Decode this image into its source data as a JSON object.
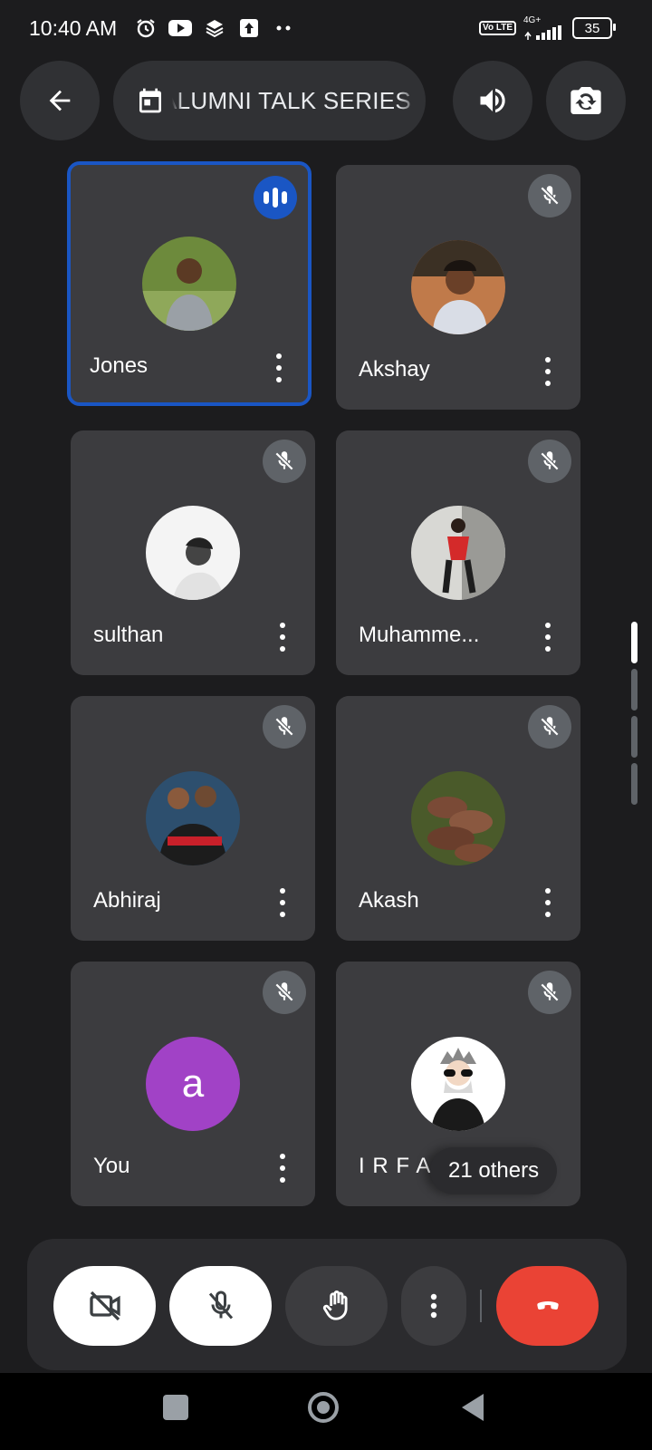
{
  "status_bar": {
    "time": "10:40 AM",
    "notification_icons": [
      "alarm-icon",
      "youtube-icon",
      "layers-icon",
      "upload-icon",
      "more-dots-icon"
    ],
    "network_badge": "Vo LTE",
    "network_type": "4G+",
    "battery": "35"
  },
  "header": {
    "back_icon": "arrow-back-icon",
    "meeting_title": "ALUMNI TALK SERIES",
    "calendar_icon": "calendar-icon",
    "audio_icon": "speaker-icon",
    "switch_camera_icon": "switch-camera-icon"
  },
  "participants": [
    {
      "name": "Jones",
      "speaking": true,
      "muted": false
    },
    {
      "name": "Akshay",
      "speaking": false,
      "muted": true
    },
    {
      "name": "sulthan",
      "speaking": false,
      "muted": true
    },
    {
      "name": "Muhamme...",
      "speaking": false,
      "muted": true
    },
    {
      "name": "Abhiraj",
      "speaking": false,
      "muted": true
    },
    {
      "name": "Akash",
      "speaking": false,
      "muted": true
    },
    {
      "name": "You",
      "avatar_letter": "a",
      "speaking": false,
      "muted": true
    },
    {
      "name": "I R F A D",
      "speaking": false,
      "muted": true
    }
  ],
  "others_label": "21 others",
  "controls": {
    "camera": "camera-off-icon",
    "mic": "mic-off-icon",
    "raise_hand": "hand-icon",
    "more": "more-vert-icon",
    "end_call": "end-call-icon"
  },
  "colors": {
    "background": "#1c1c1e",
    "tile": "#3c3c3f",
    "active_border": "#1a56c4",
    "end_call": "#ea4335",
    "you_avatar": "#a142c6"
  },
  "nav_bar": [
    "recents-square-icon",
    "home-circle-icon",
    "back-triangle-icon"
  ]
}
